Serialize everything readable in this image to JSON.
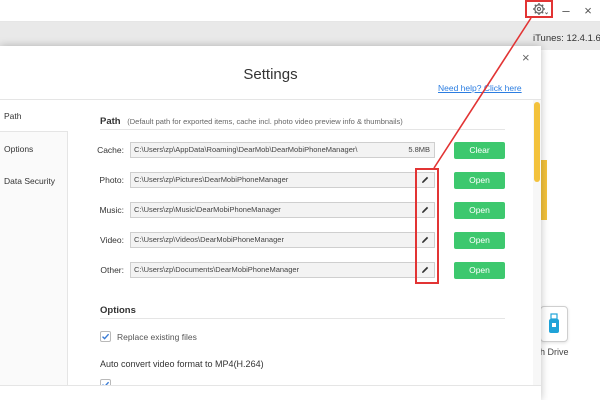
{
  "app": {
    "itunes_version": "iTunes: 12.4.1.6",
    "minimize_label": "–",
    "close_label": "×",
    "drive_label": "h Drive"
  },
  "dialog": {
    "title": "Settings",
    "help_link": "Need help? Click here",
    "close_label": "×"
  },
  "sidebar": {
    "items": [
      {
        "label": "Path"
      },
      {
        "label": "Options"
      },
      {
        "label": "Data Security"
      }
    ]
  },
  "path_section": {
    "title": "Path",
    "note": "(Default path for exported items, cache incl. photo video preview info & thumbnails)",
    "rows": [
      {
        "label": "Cache:",
        "path": "C:\\Users\\zp\\AppData\\Roaming\\DearMob\\DearMobiPhoneManager\\",
        "size": "5.8MB",
        "button": "Clear"
      },
      {
        "label": "Photo:",
        "path": "C:\\Users\\zp\\Pictures\\DearMobiPhoneManager",
        "button": "Open"
      },
      {
        "label": "Music:",
        "path": "C:\\Users\\zp\\Music\\DearMobiPhoneManager",
        "button": "Open"
      },
      {
        "label": "Video:",
        "path": "C:\\Users\\zp\\Videos\\DearMobiPhoneManager",
        "button": "Open"
      },
      {
        "label": "Other:",
        "path": "C:\\Users\\zp\\Documents\\DearMobiPhoneManager",
        "button": "Open"
      }
    ]
  },
  "options_section": {
    "title": "Options",
    "replace_existing_label": "Replace existing files",
    "replace_existing_checked": true,
    "auto_convert_label": "Auto convert video format to MP4(H.264)"
  },
  "colors": {
    "accent_green": "#3dc86e",
    "link_blue": "#2b7de1",
    "annotation_red": "#e23434",
    "scroll_yellow": "#f3c23c"
  },
  "icons": [
    "gear-icon",
    "minimize-icon",
    "close-icon",
    "pencil-icon",
    "checkmark-icon",
    "usb-drive-icon"
  ]
}
